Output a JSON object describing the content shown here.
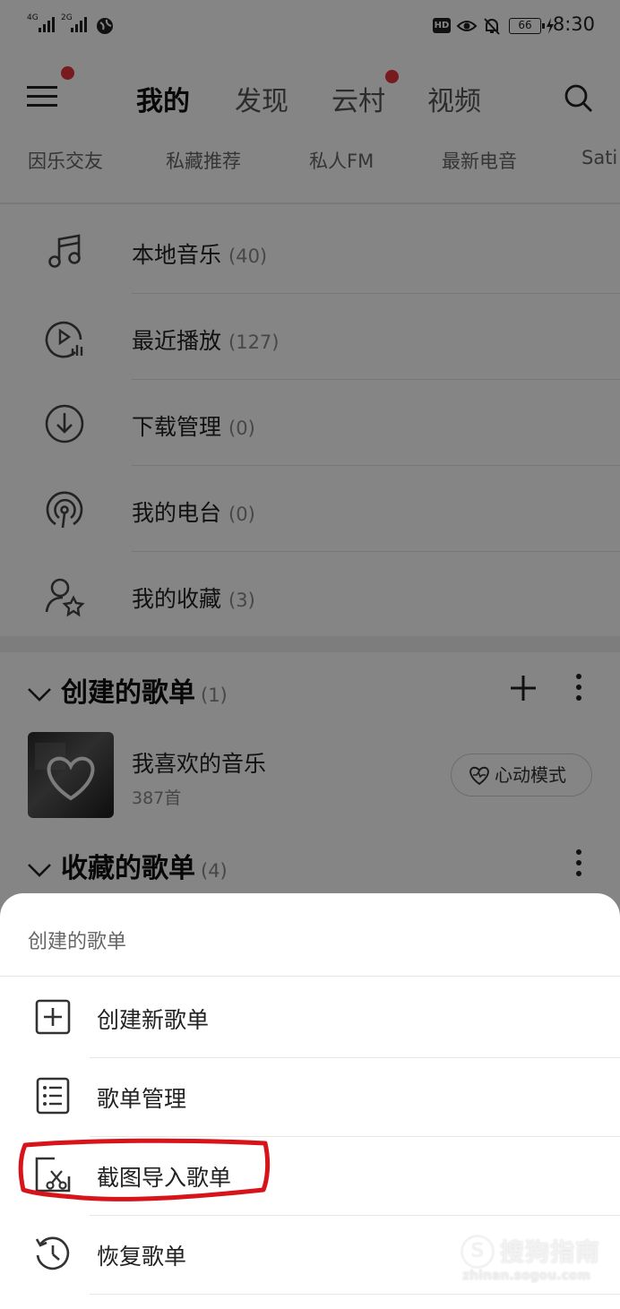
{
  "status_bar": {
    "network_1": "4G",
    "network_2": "2G",
    "hd_label": "HD",
    "battery": "66",
    "time": "8:30"
  },
  "top_nav": {
    "tabs": [
      {
        "label": "我的",
        "active": true
      },
      {
        "label": "发现",
        "active": false
      },
      {
        "label": "云村",
        "active": false,
        "badge_dot": true
      },
      {
        "label": "视频",
        "active": false
      }
    ]
  },
  "sub_nav": [
    "因乐交友",
    "私藏推荐",
    "私人FM",
    "最新电音",
    "Sati"
  ],
  "library": [
    {
      "label": "本地音乐",
      "count": "(40)",
      "icon": "music-note-icon"
    },
    {
      "label": "最近播放",
      "count": "(127)",
      "icon": "recent-play-icon"
    },
    {
      "label": "下载管理",
      "count": "(0)",
      "icon": "download-icon"
    },
    {
      "label": "我的电台",
      "count": "(0)",
      "icon": "radio-icon"
    },
    {
      "label": "我的收藏",
      "count": "(3)",
      "icon": "user-star-icon"
    }
  ],
  "created_section": {
    "title": "创建的歌单",
    "count": "(1)"
  },
  "playlist": {
    "title": "我喜欢的音乐",
    "subtitle": "387首",
    "heart_mode_label": "心动模式"
  },
  "collected_section": {
    "title": "收藏的歌单",
    "count": "(4)"
  },
  "sheet": {
    "title": "创建的歌单",
    "items": [
      {
        "label": "创建新歌单",
        "icon": "plus-square-icon"
      },
      {
        "label": "歌单管理",
        "icon": "list-icon"
      },
      {
        "label": "截图导入歌单",
        "icon": "screenshot-cut-icon"
      },
      {
        "label": "恢复歌单",
        "icon": "history-icon"
      }
    ]
  },
  "watermark": {
    "text": "搜狗指南",
    "url": "zhinan.sogou.com"
  },
  "colors": {
    "badge_red": "#e4353b",
    "highlight_red": "#d8141b"
  }
}
